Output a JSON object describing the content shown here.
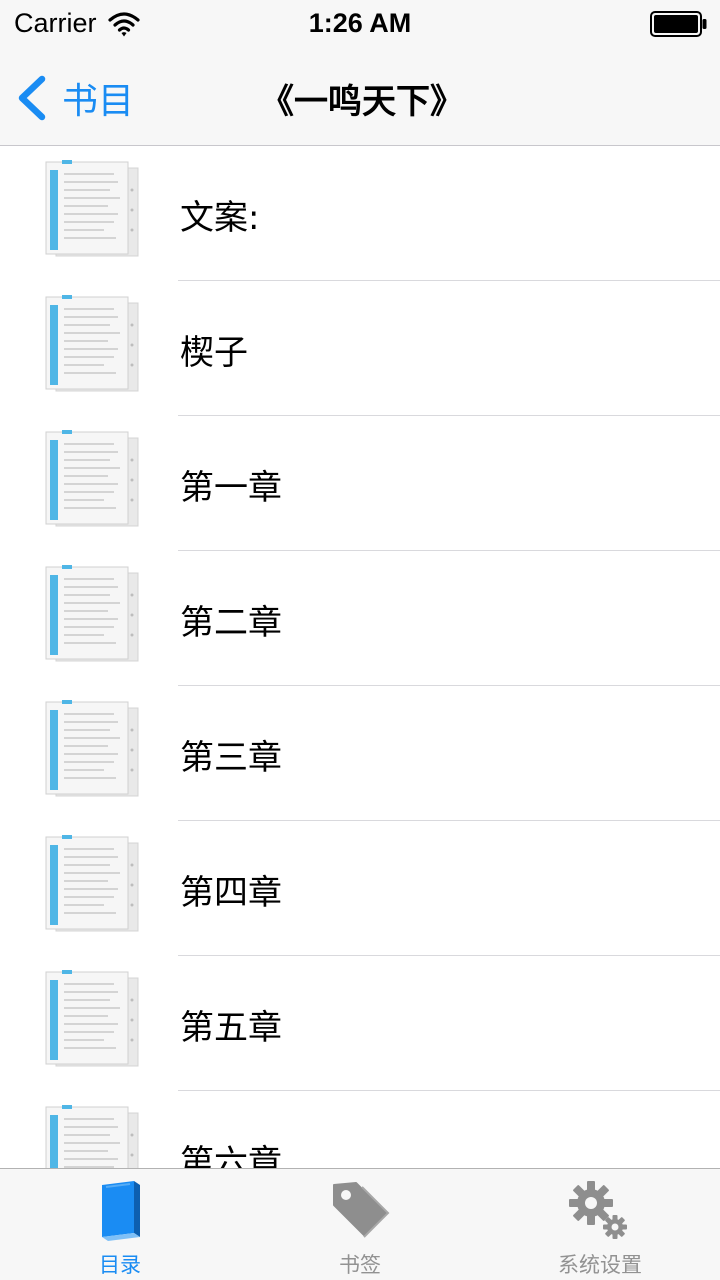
{
  "status_bar": {
    "carrier": "Carrier",
    "time": "1:26 AM",
    "wifi_icon": "wifi-icon",
    "battery_icon": "battery-icon"
  },
  "nav_bar": {
    "back_label": "书目",
    "back_icon": "chevron-left-icon",
    "title": "《一鸣天下》"
  },
  "chapters": [
    {
      "title": "文案:",
      "icon": "document-icon"
    },
    {
      "title": "楔子",
      "icon": "document-icon"
    },
    {
      "title": "第一章",
      "icon": "document-icon"
    },
    {
      "title": "第二章",
      "icon": "document-icon"
    },
    {
      "title": "第三章",
      "icon": "document-icon"
    },
    {
      "title": "第四章",
      "icon": "document-icon"
    },
    {
      "title": "第五章",
      "icon": "document-icon"
    },
    {
      "title": "第六章",
      "icon": "document-icon"
    }
  ],
  "tab_bar": {
    "tabs": [
      {
        "label": "目录",
        "icon": "book-icon",
        "active": true
      },
      {
        "label": "书签",
        "icon": "tag-icon",
        "active": false
      },
      {
        "label": "系统设置",
        "icon": "gears-icon",
        "active": false
      }
    ]
  },
  "colors": {
    "accent": "#1a8cf3",
    "inactive_tab": "#929292",
    "bar_background": "#f7f7f7",
    "divider": "#d9d9dd"
  }
}
